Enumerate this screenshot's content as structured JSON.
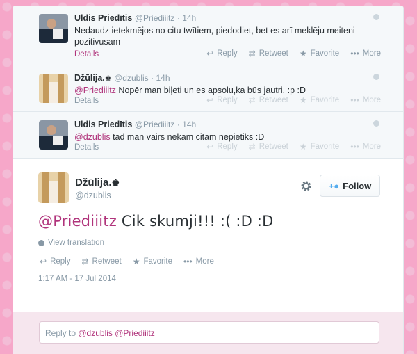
{
  "context_tweets": [
    {
      "name": "Uldis Priedītis",
      "handle": "@Priediiitz",
      "time": "14h",
      "text_parts": [
        "",
        "Nedaudz ietekmējos no citu twītiem, piedodiet, bet es arī meklēju meiteni pozitivusam"
      ],
      "mention": "",
      "details": "Details"
    },
    {
      "name": "Džūlija.",
      "handle": "@dzublis",
      "time": "14h",
      "mention": "@Priediiitz",
      "text": " Nopēr man biļeti un es apsolu,ka būs jautri. :p :D",
      "details": "Details"
    },
    {
      "name": "Uldis Priedītis",
      "handle": "@Priediiitz",
      "time": "14h",
      "mention": "@dzublis",
      "text": " tad man vairs nekam citam nepietiks :D",
      "details": "Details"
    }
  ],
  "actions": {
    "reply": "Reply",
    "retweet": "Retweet",
    "favorite": "Favorite",
    "more": "More"
  },
  "main_tweet": {
    "name": "Džūlija.",
    "handle": "@dzublis",
    "mention": "@Priediiitz",
    "text": "  Cik skumji!!! :( :D :D",
    "view_translation": "View translation",
    "timestamp": "1:17 AM - 17 Jul 2014",
    "follow_label": "Follow"
  },
  "reply_box": {
    "prefix": "Reply to ",
    "mentions": "@dzublis @Priediiitz"
  },
  "colors": {
    "accent": "#b0337b",
    "background": "#f6a7c9"
  }
}
